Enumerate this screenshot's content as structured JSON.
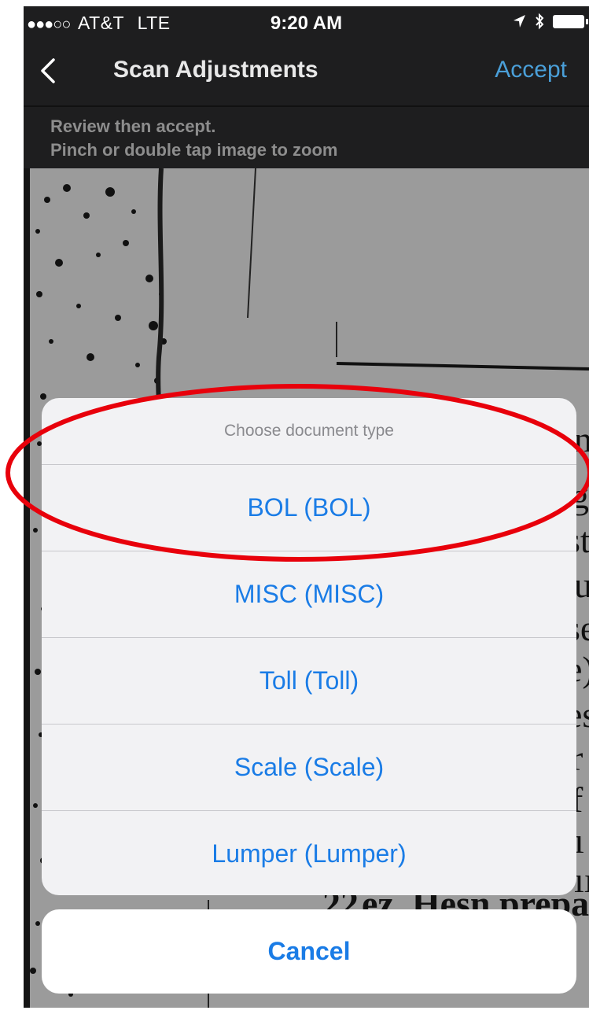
{
  "status_bar": {
    "signal": "●●●○○",
    "carrier": "AT&T",
    "network": "LTE",
    "time": "9:20 AM"
  },
  "nav": {
    "title": "Scan Adjustments",
    "accept_label": "Accept"
  },
  "hint": {
    "line1": "Review then accept.",
    "line2": "Pinch or double tap image to zoom"
  },
  "action_sheet": {
    "title": "Choose document type",
    "options": [
      {
        "label": "BOL (BOL)"
      },
      {
        "label": "MISC (MISC)"
      },
      {
        "label": "Toll (Toll)"
      },
      {
        "label": "Scale (Scale)"
      },
      {
        "label": "Lumper (Lumper)"
      }
    ],
    "cancel_label": "Cancel"
  },
  "scan_text": {
    "fragments": [
      "n",
      "g",
      "st",
      "u",
      "se",
      "e)",
      "es",
      "r",
      "f",
      "ı",
      "ıı",
      "22 ",
      "ez. Hesn prepa"
    ]
  },
  "colors": {
    "accent": "#1a7ce6",
    "nav_accent": "#4a9fd8",
    "highlight": "#e8000b"
  }
}
